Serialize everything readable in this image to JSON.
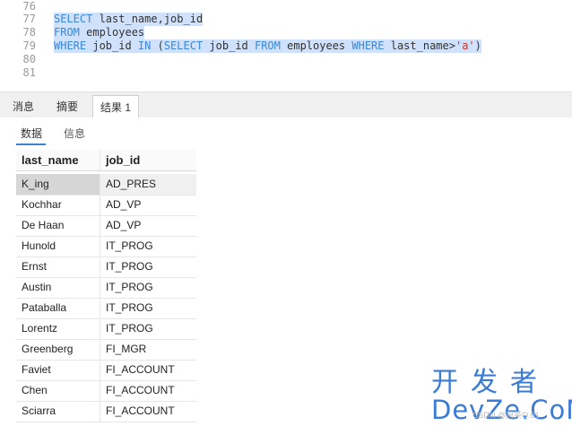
{
  "editor": {
    "lines": [
      {
        "num": "76",
        "parts": []
      },
      {
        "num": "77",
        "parts": [
          {
            "t": "SELECT",
            "k": "kw"
          },
          {
            "t": " last_name,job_id",
            "k": ""
          }
        ]
      },
      {
        "num": "78",
        "parts": [
          {
            "t": "FROM",
            "k": "kw"
          },
          {
            "t": " employees",
            "k": ""
          }
        ]
      },
      {
        "num": "79",
        "parts": [
          {
            "t": "WHERE",
            "k": "kw"
          },
          {
            "t": " job_id ",
            "k": ""
          },
          {
            "t": "IN",
            "k": "kw"
          },
          {
            "t": " (",
            "k": ""
          },
          {
            "t": "SELECT",
            "k": "kw"
          },
          {
            "t": " job_id ",
            "k": ""
          },
          {
            "t": "FROM",
            "k": "kw"
          },
          {
            "t": " employees ",
            "k": ""
          },
          {
            "t": "WHERE",
            "k": "kw"
          },
          {
            "t": " last_name>",
            "k": ""
          },
          {
            "t": "'a'",
            "k": "str"
          },
          {
            "t": ")",
            "k": ""
          }
        ]
      },
      {
        "num": "80",
        "parts": []
      },
      {
        "num": "81",
        "parts": []
      }
    ]
  },
  "result_tabs": [
    {
      "label": "消息",
      "active": false
    },
    {
      "label": "摘要",
      "active": false
    },
    {
      "label": "结果 1",
      "active": true
    }
  ],
  "sub_tabs": [
    {
      "label": "数据",
      "active": true
    },
    {
      "label": "信息",
      "active": false
    }
  ],
  "table": {
    "columns": [
      "last_name",
      "job_id"
    ],
    "rows": [
      [
        "K_ing",
        "AD_PRES"
      ],
      [
        "Kochhar",
        "AD_VP"
      ],
      [
        "De Haan",
        "AD_VP"
      ],
      [
        "Hunold",
        "IT_PROG"
      ],
      [
        "Ernst",
        "IT_PROG"
      ],
      [
        "Austin",
        "IT_PROG"
      ],
      [
        "Pataballa",
        "IT_PROG"
      ],
      [
        "Lorentz",
        "IT_PROG"
      ],
      [
        "Greenberg",
        "FI_MGR"
      ],
      [
        "Faviet",
        "FI_ACCOUNT"
      ],
      [
        "Chen",
        "FI_ACCOUNT"
      ],
      [
        "Sciarra",
        "FI_ACCOUNT"
      ]
    ]
  },
  "logo": {
    "top": "开发者",
    "bottom": "DevZe.CoM"
  },
  "watermark": "CSDN @阿茶Q.01",
  "colors": {
    "accent": "#3b82d6",
    "keyword": "#3d86d8",
    "string": "#c0392b",
    "selection": "#cfe1fb"
  }
}
